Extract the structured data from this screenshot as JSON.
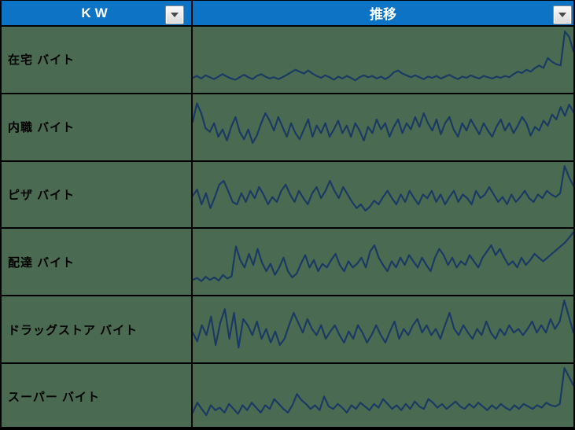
{
  "header": {
    "col1": "KW",
    "col2": "推移"
  },
  "icons": {
    "filter_dropdown": "chevron-down triangle"
  },
  "colors": {
    "header_bg": "#0D73C5",
    "header_text": "#FFFFFF",
    "cell_bg": "#4A6B52",
    "border": "#000000",
    "spark_line": "#1B3A63",
    "label_text": "#000000"
  },
  "chart_data": [
    {
      "type": "line",
      "label": "在宅 バイト",
      "legend": "sparkline trend, mostly flat low with sharp spike at far right",
      "ylim": [
        0,
        100
      ],
      "values": [
        20,
        23,
        19,
        24,
        21,
        18,
        22,
        26,
        22,
        19,
        17,
        21,
        25,
        21,
        18,
        23,
        26,
        22,
        19,
        21,
        18,
        21,
        25,
        29,
        33,
        30,
        27,
        32,
        27,
        23,
        20,
        24,
        21,
        17,
        22,
        19,
        23,
        20,
        16,
        21,
        24,
        21,
        23,
        19,
        22,
        18,
        22,
        29,
        32,
        27,
        24,
        21,
        24,
        21,
        18,
        22,
        20,
        23,
        19,
        22,
        25,
        21,
        18,
        22,
        20,
        24,
        21,
        19,
        23,
        21,
        19,
        22,
        20,
        23,
        21,
        26,
        30,
        28,
        33,
        30,
        36,
        40,
        36,
        52,
        46,
        42,
        40,
        95,
        86,
        63
      ]
    },
    {
      "type": "line",
      "label": "内職 バイト",
      "legend": "sparkline trend, high-variance oscillation across full height",
      "ylim": [
        0,
        100
      ],
      "values": [
        58,
        88,
        72,
        48,
        42,
        56,
        34,
        46,
        28,
        50,
        66,
        42,
        30,
        46,
        24,
        36,
        56,
        72,
        60,
        44,
        66,
        50,
        34,
        56,
        40,
        30,
        46,
        62,
        34,
        52,
        40,
        56,
        34,
        46,
        60,
        40,
        52,
        34,
        56,
        44,
        28,
        50,
        40,
        62,
        46,
        56,
        34,
        50,
        62,
        40,
        56,
        46,
        66,
        50,
        72,
        56,
        44,
        62,
        38,
        56,
        66,
        46,
        34,
        56,
        44,
        62,
        50,
        38,
        56,
        44,
        34,
        50,
        62,
        44,
        56,
        40,
        52,
        66,
        56,
        36,
        50,
        44,
        60,
        52,
        70,
        62,
        82,
        68,
        86,
        74
      ]
    },
    {
      "type": "line",
      "label": "ピザ バイト",
      "legend": "sparkline trend, mid-level oscillation with tall spike at far right",
      "ylim": [
        0,
        100
      ],
      "values": [
        48,
        58,
        34,
        52,
        28,
        46,
        66,
        72,
        56,
        38,
        34,
        52,
        38,
        56,
        44,
        62,
        50,
        34,
        46,
        38,
        56,
        66,
        50,
        38,
        56,
        44,
        34,
        52,
        62,
        44,
        56,
        72,
        56,
        44,
        62,
        50,
        38,
        28,
        34,
        24,
        30,
        40,
        34,
        46,
        56,
        44,
        34,
        50,
        38,
        56,
        44,
        34,
        50,
        44,
        56,
        38,
        50,
        34,
        46,
        56,
        38,
        50,
        44,
        34,
        56,
        44,
        50,
        62,
        50,
        38,
        46,
        34,
        50,
        38,
        46,
        56,
        44,
        38,
        50,
        44,
        56,
        50,
        46,
        52,
        96,
        78,
        64
      ]
    },
    {
      "type": "line",
      "label": "配達 バイト",
      "legend": "sparkline trend, low start, spiky middle, rising strongly to top at right",
      "ylim": [
        0,
        100
      ],
      "values": [
        20,
        23,
        18,
        25,
        20,
        24,
        19,
        28,
        22,
        26,
        74,
        52,
        40,
        62,
        44,
        70,
        48,
        34,
        46,
        28,
        40,
        56,
        34,
        24,
        30,
        46,
        60,
        40,
        52,
        34,
        46,
        40,
        52,
        62,
        44,
        34,
        50,
        40,
        46,
        56,
        40,
        66,
        76,
        56,
        44,
        34,
        50,
        40,
        56,
        44,
        60,
        50,
        40,
        56,
        44,
        34,
        56,
        70,
        60,
        44,
        56,
        40,
        50,
        44,
        60,
        50,
        40,
        56,
        66,
        76,
        60,
        70,
        56,
        44,
        50,
        40,
        56,
        44,
        52,
        62,
        56,
        50,
        56,
        62,
        68,
        74,
        80,
        88,
        97
      ]
    },
    {
      "type": "line",
      "label": "ドラッグストア バイト",
      "legend": "sparkline trend, very spiky early section, oscillating middle, spike near right end",
      "ylim": [
        0,
        100
      ],
      "values": [
        44,
        30,
        56,
        40,
        70,
        24,
        60,
        82,
        34,
        76,
        20,
        66,
        56,
        40,
        62,
        34,
        50,
        28,
        46,
        24,
        34,
        56,
        76,
        60,
        44,
        66,
        50,
        40,
        56,
        34,
        46,
        56,
        40,
        28,
        46,
        34,
        56,
        44,
        28,
        40,
        56,
        40,
        28,
        46,
        62,
        34,
        50,
        40,
        56,
        66,
        44,
        56,
        40,
        50,
        34,
        56,
        76,
        50,
        40,
        56,
        44,
        34,
        50,
        40,
        62,
        44,
        34,
        50,
        40,
        56,
        44,
        50,
        40,
        50,
        62,
        44,
        56,
        44,
        66,
        50,
        62,
        96,
        70,
        44
      ]
    },
    {
      "type": "line",
      "label": "スーパー バイト",
      "legend": "sparkline trend, flat noisy low band with sharp spike at far right",
      "ylim": [
        0,
        100
      ],
      "values": [
        24,
        40,
        30,
        20,
        36,
        28,
        32,
        24,
        38,
        30,
        22,
        36,
        28,
        40,
        32,
        24,
        36,
        30,
        46,
        38,
        30,
        24,
        36,
        54,
        44,
        38,
        30,
        36,
        28,
        50,
        34,
        30,
        38,
        32,
        24,
        36,
        30,
        40,
        34,
        28,
        38,
        32,
        46,
        38,
        30,
        36,
        28,
        38,
        30,
        42,
        34,
        30,
        46,
        40,
        32,
        38,
        30,
        36,
        42,
        34,
        30,
        38,
        32,
        40,
        34,
        28,
        36,
        30,
        38,
        32,
        28,
        36,
        30,
        38,
        34,
        30,
        36,
        32,
        40,
        36,
        34,
        38,
        96,
        82,
        68
      ]
    }
  ]
}
